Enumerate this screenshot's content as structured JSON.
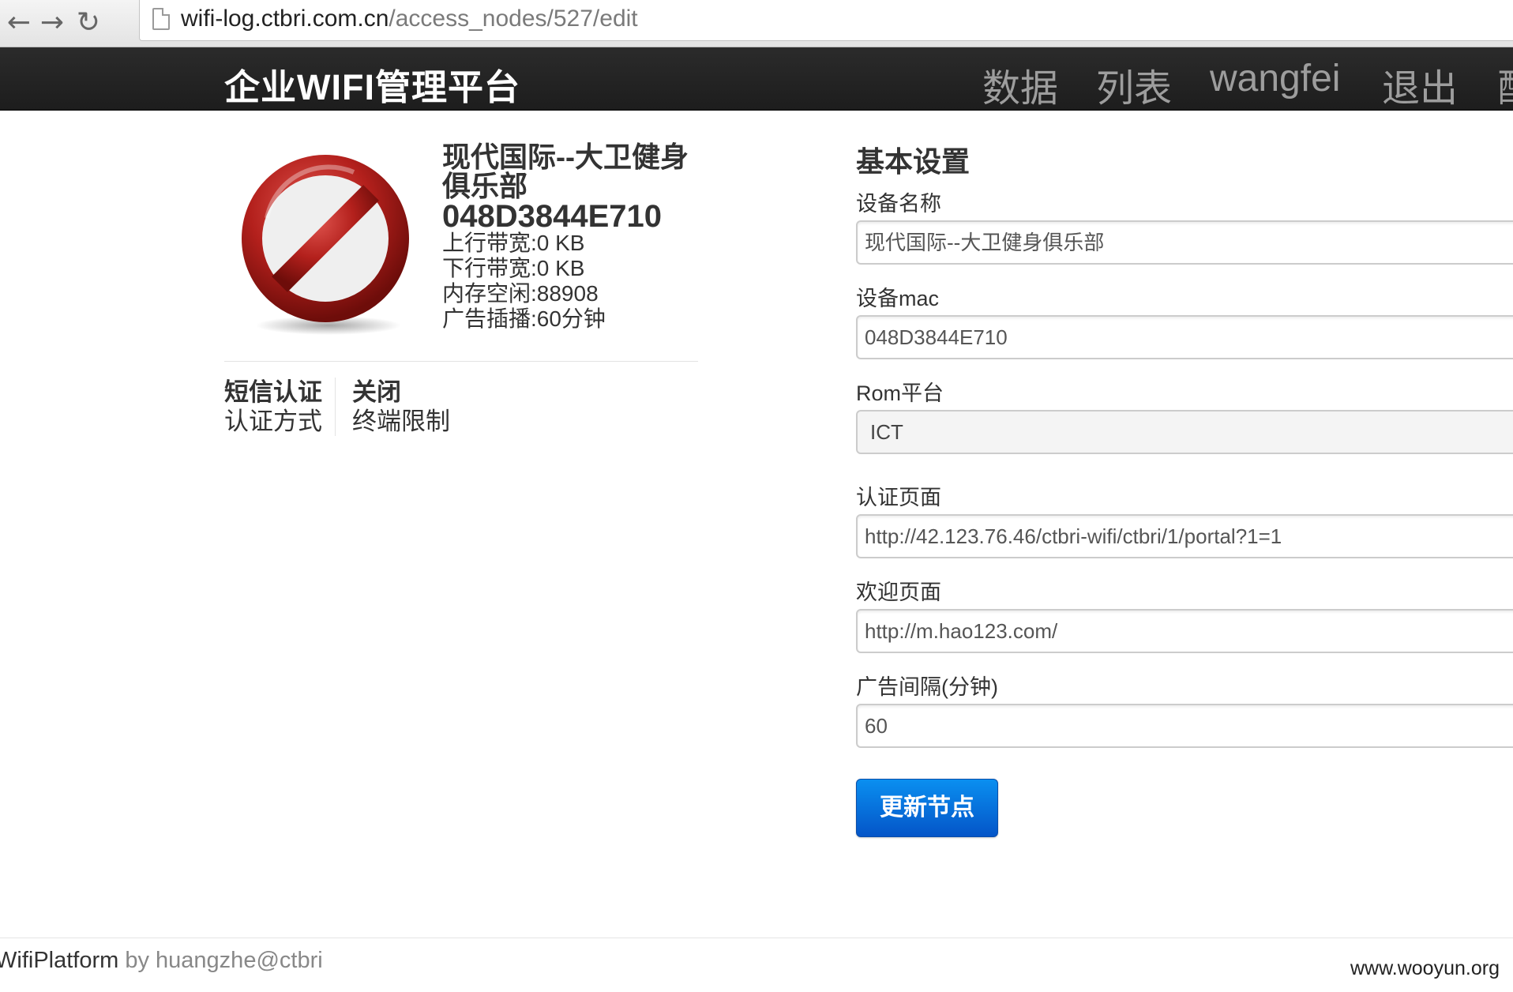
{
  "browser": {
    "url_host": "wifi-log.ctbri.com.cn",
    "url_path": "/access_nodes/527/edit",
    "back_icon": "arrow-left-icon",
    "forward_icon": "arrow-right-icon",
    "reload_icon": "reload-icon"
  },
  "navbar": {
    "brand": "企业WIFI管理平台",
    "items": [
      "数据",
      "列表",
      "wangfei",
      "退出",
      "配"
    ]
  },
  "node": {
    "status_icon": "prohibited-icon",
    "name": "现代国际--大卫健身俱乐部",
    "mac": "048D3844E710",
    "stats": [
      "上行带宽:0 KB",
      "下行带宽:0 KB",
      "内存空闲:88908",
      "广告插播:60分钟"
    ],
    "auth": {
      "value": "短信认证",
      "label": "认证方式"
    },
    "limit": {
      "value": "关闭",
      "label": "终端限制"
    }
  },
  "form": {
    "title": "基本设置",
    "fields": [
      {
        "label": "设备名称",
        "value": "现代国际--大卫健身俱乐部"
      },
      {
        "label": "设备mac",
        "value": "048D3844E710"
      },
      {
        "label": "Rom平台",
        "value": "ICT"
      },
      {
        "label": "认证页面",
        "value": "http://42.123.76.46/ctbri-wifi/ctbri/1/portal?1=1"
      },
      {
        "label": "欢迎页面",
        "value": "http://m.hao123.com/"
      },
      {
        "label": "广告间隔(分钟)",
        "value": "60"
      }
    ],
    "submit_label": "更新节点"
  },
  "footer": {
    "product": "WifiPlatform",
    "by": "by huangzhe@ctbri"
  },
  "watermark": "www.wooyun.org",
  "colors": {
    "navbar_bg": "#222222",
    "primary_button": "#0668dc",
    "prohibited_red": "#b3201c"
  }
}
